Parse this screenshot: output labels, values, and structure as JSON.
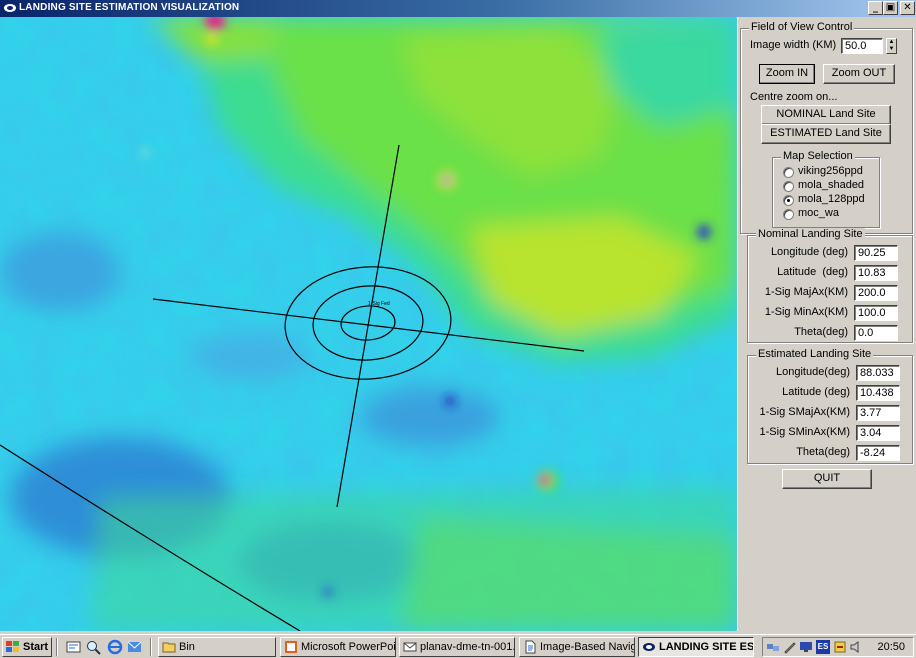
{
  "window": {
    "title": "LANDING SITE ESTIMATION VISUALIZATION",
    "min_glyph": "_",
    "max_glyph": "▣",
    "close_glyph": "✕"
  },
  "map": {
    "ellipse_label": "1-Sig Fed",
    "colors": {
      "low": "#32d8ea",
      "mid": "#3cdc98",
      "high": "#7fe12a",
      "peak": "#d6e52a",
      "crater": "#e0288c"
    }
  },
  "fov": {
    "legend": "Field of View Control",
    "image_width_label": "Image width (KM)",
    "image_width_value": "50.0",
    "zoom_in": "Zoom IN",
    "zoom_out": "Zoom OUT",
    "centre_label": "Centre zoom on...",
    "nominal_button": "NOMINAL Land Site",
    "estimated_button": "ESTIMATED Land Site",
    "map_selection": {
      "legend": "Map Selection",
      "options": [
        {
          "label": "viking256ppd",
          "selected": false
        },
        {
          "label": "mola_shaded",
          "selected": false
        },
        {
          "label": "mola_128ppd",
          "selected": true
        },
        {
          "label": "moc_wa",
          "selected": false
        }
      ]
    }
  },
  "nominal": {
    "legend": "Nominal Landing Site",
    "rows": [
      {
        "label": "Longitude (deg)",
        "value": "90.25"
      },
      {
        "label": "Latitude  (deg)",
        "value": "10.83"
      },
      {
        "label": "1-Sig MajAx(KM)",
        "value": "200.0"
      },
      {
        "label": "1-Sig MinAx(KM)",
        "value": "100.0"
      },
      {
        "label": "Theta(deg)",
        "value": "0.0"
      }
    ]
  },
  "estimated": {
    "legend": "Estimated Landing Site",
    "rows": [
      {
        "label": "Longitude(deg)",
        "value": "88.033"
      },
      {
        "label": "Latitude (deg)",
        "value": "10.438"
      },
      {
        "label": "1-Sig SMajAx(KM)",
        "value": "3.77"
      },
      {
        "label": "1-Sig SMinAx(KM)",
        "value": "3.04"
      },
      {
        "label": "Theta(deg)",
        "value": "-8.24"
      }
    ]
  },
  "quit_label": "QUIT",
  "taskbar": {
    "start_label": "Start",
    "tasks": [
      {
        "label": "Bin",
        "icon": "folder-icon",
        "active": false
      },
      {
        "label": "Microsoft PowerPoi...",
        "icon": "powerpoint-icon",
        "active": false
      },
      {
        "label": "planav-dme-tn-001...",
        "icon": "mail-icon",
        "active": false
      },
      {
        "label": "Image-Based Navig...",
        "icon": "document-icon",
        "active": false
      },
      {
        "label": "LANDING SITE ES...",
        "icon": "app-icon",
        "active": true
      }
    ],
    "tray_lang": "ES",
    "clock": "20:50"
  }
}
